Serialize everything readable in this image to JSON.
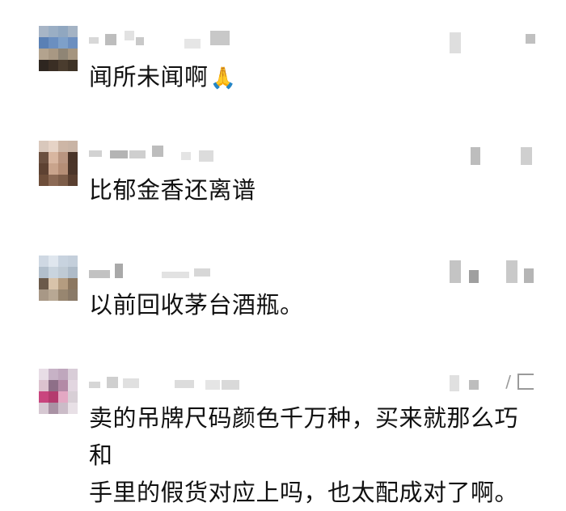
{
  "comments": [
    {
      "text": "闻所未闻啊",
      "emoji": "🙏",
      "avatar_colors": [
        "#a7b5c6",
        "#9aaec4",
        "#90a7c0",
        "#a4b3c4",
        "#5a80b5",
        "#6b8fc0",
        "#7ea0c9",
        "#6c8fc0",
        "#b3a38e",
        "#a89883",
        "#8f8575",
        "#a5957f",
        "#2e2620",
        "#3a2e24",
        "#4a3c2e",
        "#3e3226"
      ]
    },
    {
      "text": "比郁金香还离谱",
      "emoji": "",
      "avatar_colors": [
        "#d9c8bc",
        "#e6d3c6",
        "#cdb6a6",
        "#c9b4a5",
        "#6b5040",
        "#d8b6a0",
        "#b99580",
        "#4a3428",
        "#5e4232",
        "#c9a48c",
        "#b58e76",
        "#4b3529",
        "#6e4e3a",
        "#8c6a55",
        "#7d5d49",
        "#5a3f30"
      ]
    },
    {
      "text": "以前回收茅台酒瓶。",
      "emoji": "",
      "avatar_colors": [
        "#cfd8e3",
        "#dfe6ee",
        "#c8d3df",
        "#c4cfdb",
        "#b2bfcc",
        "#c9d4de",
        "#bfcad4",
        "#aebbc8",
        "#6b5a4a",
        "#d8c3aa",
        "#b49c80",
        "#8c7760",
        "#a89886",
        "#b8a894",
        "#988670",
        "#8a7a68"
      ]
    },
    {
      "text": "卖的吊牌尺码颜色千万种，买来就那么巧和\n手里的假货对应上吗，也太配成对了啊。",
      "emoji": "",
      "avatar_colors": [
        "#e8dde6",
        "#c7b2c6",
        "#bfa7bd",
        "#d9cdd8",
        "#dcc2cf",
        "#8e6f88",
        "#b38aa6",
        "#e2d6e0",
        "#c9457e",
        "#b43b6e",
        "#e3a8c3",
        "#d8cfd6",
        "#d6c8d2",
        "#a992a4",
        "#cbbcc8",
        "#e8e0e6"
      ]
    }
  ]
}
